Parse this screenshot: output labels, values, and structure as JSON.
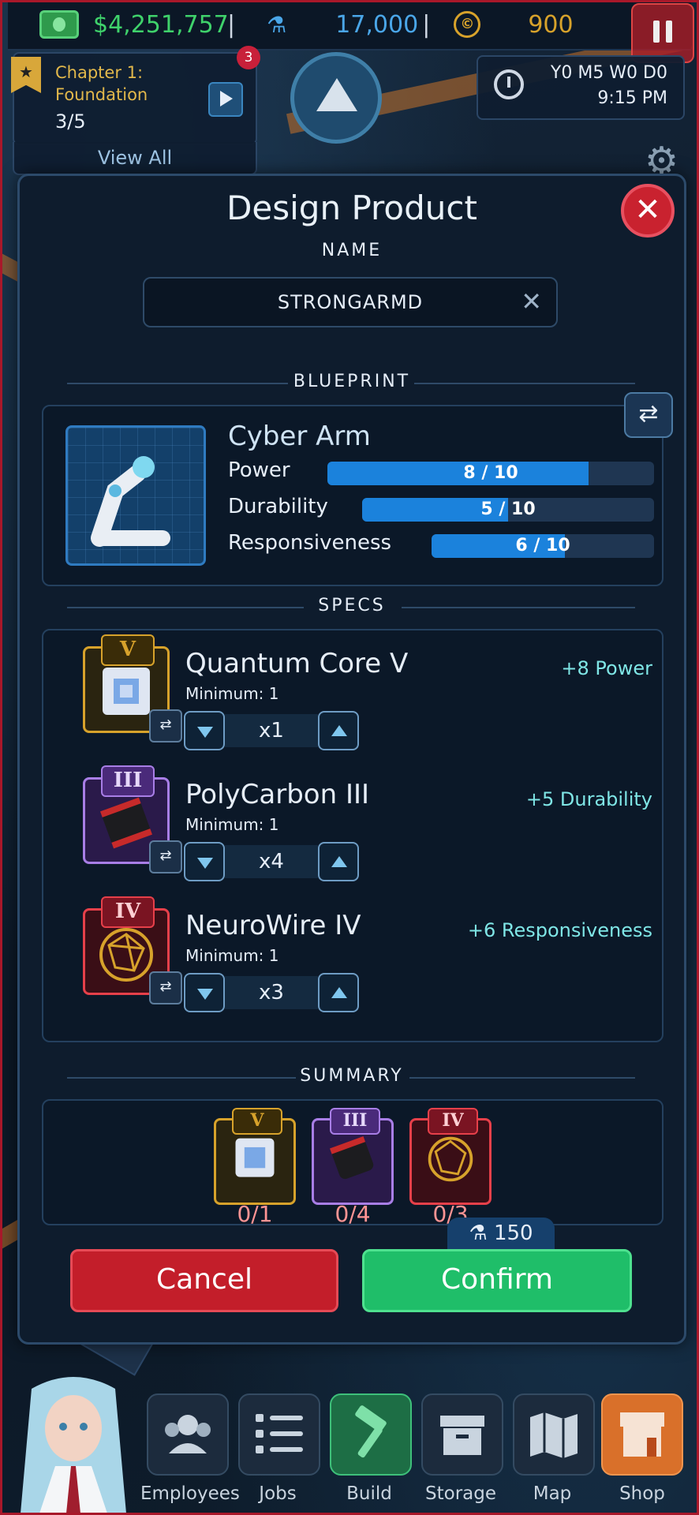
{
  "topbar": {
    "money": "$4,251,757",
    "separator": "|",
    "research": "17,000",
    "coins": "900",
    "money_color": "#3fd26b",
    "research_color": "#4aa6e8",
    "coins_color": "#d7a22b"
  },
  "chapter": {
    "title": "Chapter 1: Foundation",
    "progress": "3/5",
    "badge_count": "3",
    "view_all": "View All"
  },
  "clock": {
    "date": "Y0 M5 W0 D0",
    "time": "9:15 PM"
  },
  "modal": {
    "title": "Design Product",
    "close_glyph": "✕",
    "name_label": "NAME",
    "name_value": "STRONGARMD",
    "clear_glyph": "✕",
    "blueprint_label": "BLUEPRINT",
    "blueprint": {
      "name": "Cyber Arm",
      "swap_glyph": "⇄",
      "stats": [
        {
          "label": "Power",
          "value": 8,
          "max": 10,
          "text": "8 / 10"
        },
        {
          "label": "Durability",
          "value": 5,
          "max": 10,
          "text": "5 / 10"
        },
        {
          "label": "Responsiveness",
          "value": 6,
          "max": 10,
          "text": "6 / 10"
        }
      ]
    },
    "specs_label": "SPECS",
    "specs": [
      {
        "tier": "V",
        "name": "Quantum Core V",
        "minimum": "Minimum: 1",
        "qty": "x1",
        "bonus": "+8 Power",
        "tier_color": "#d7a22b",
        "bg": "#2a2410",
        "icon": "quantum-core-icon"
      },
      {
        "tier": "III",
        "name": "PolyCarbon III",
        "minimum": "Minimum: 1",
        "qty": "x4",
        "bonus": "+5 Durability",
        "tier_color": "#a87ee6",
        "bg": "#2a1a4a",
        "icon": "polycarbon-icon"
      },
      {
        "tier": "IV",
        "name": "NeuroWire IV",
        "minimum": "Minimum: 1",
        "qty": "x3",
        "bonus": "+6 Responsiveness",
        "tier_color": "#e6404a",
        "bg": "#3a0e16",
        "icon": "neurowire-icon"
      }
    ],
    "summary_label": "SUMMARY",
    "summary": [
      {
        "tier": "V",
        "count": "0/1"
      },
      {
        "tier": "III",
        "count": "0/4"
      },
      {
        "tier": "IV",
        "count": "0/3"
      }
    ],
    "cost": "150",
    "cancel_label": "Cancel",
    "confirm_label": "Confirm"
  },
  "nav": [
    {
      "label": "Employees",
      "icon": "employees-icon"
    },
    {
      "label": "Jobs",
      "icon": "jobs-icon"
    },
    {
      "label": "Build",
      "icon": "hammer-icon"
    },
    {
      "label": "Storage",
      "icon": "storage-icon"
    },
    {
      "label": "Map",
      "icon": "map-icon"
    },
    {
      "label": "Shop",
      "icon": "shop-icon"
    }
  ]
}
